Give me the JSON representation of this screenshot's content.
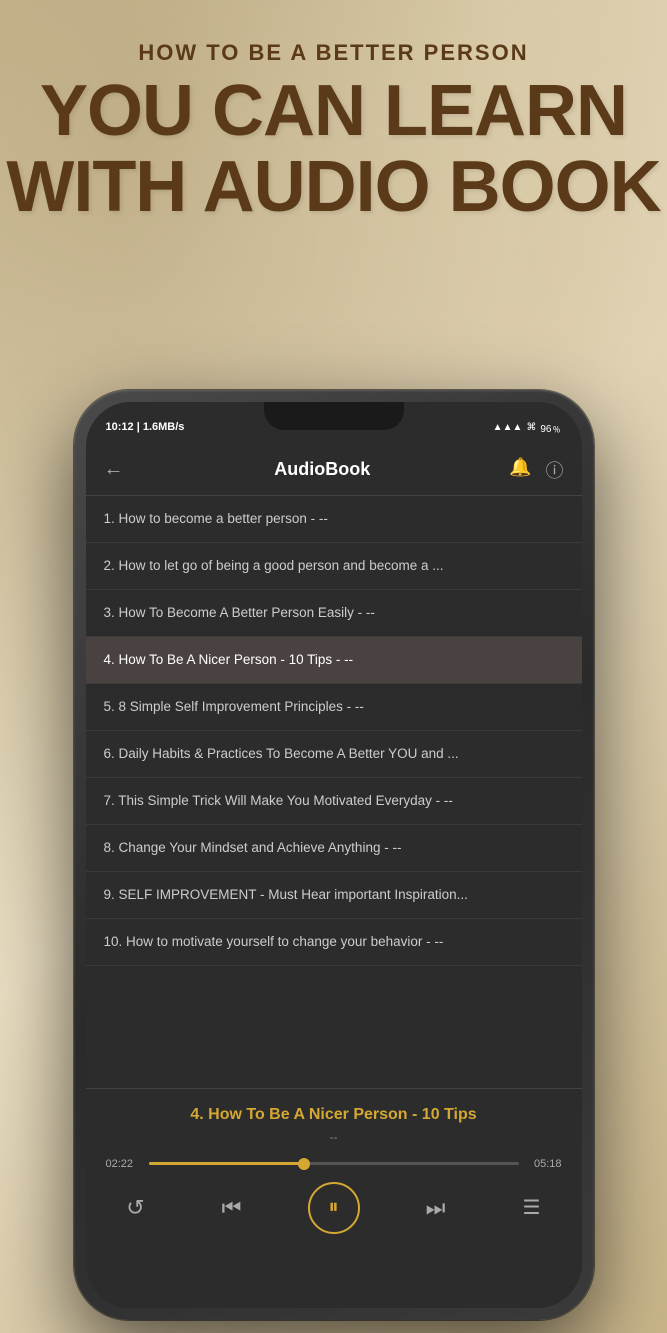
{
  "header": {
    "subtitle": "HOW TO BE A BETTER PERSON",
    "main_line1": "YOU CAN LEARN",
    "main_line2": "WITH AUDIO BOOK"
  },
  "status_bar": {
    "time": "10:12 | 1.6MB/s",
    "signal": "▲▲▲",
    "wifi": "WiFi",
    "battery": "96"
  },
  "app": {
    "title": "AudioBook",
    "back_label": "←"
  },
  "tracks": [
    {
      "id": 1,
      "label": "1. How to become a better person - --"
    },
    {
      "id": 2,
      "label": "2. How to let go of being a good person and become a ..."
    },
    {
      "id": 3,
      "label": "3. How To Become A Better Person Easily - --"
    },
    {
      "id": 4,
      "label": "4. How To Be A Nicer Person - 10 Tips - --",
      "active": true
    },
    {
      "id": 5,
      "label": "5. 8 Simple Self Improvement Principles - --"
    },
    {
      "id": 6,
      "label": "6. Daily Habits & Practices To Become A Better YOU and ..."
    },
    {
      "id": 7,
      "label": "7. This Simple Trick Will Make You Motivated Everyday - --"
    },
    {
      "id": 8,
      "label": "8. Change Your Mindset and Achieve Anything - --"
    },
    {
      "id": 9,
      "label": "9. SELF IMPROVEMENT - Must Hear important Inspiration..."
    },
    {
      "id": 10,
      "label": "10. How to motivate yourself to change your behavior - --"
    }
  ],
  "now_playing": {
    "title": "4. How To Be A Nicer Person - 10 Tips",
    "subtitle": "--",
    "current_time": "02:22",
    "total_time": "05:18",
    "progress_percent": 42
  },
  "controls": {
    "replay_icon": "↺",
    "prev_icon": "⏮",
    "play_icon": "⏸",
    "next_icon": "⏭",
    "playlist_icon": "≡"
  }
}
